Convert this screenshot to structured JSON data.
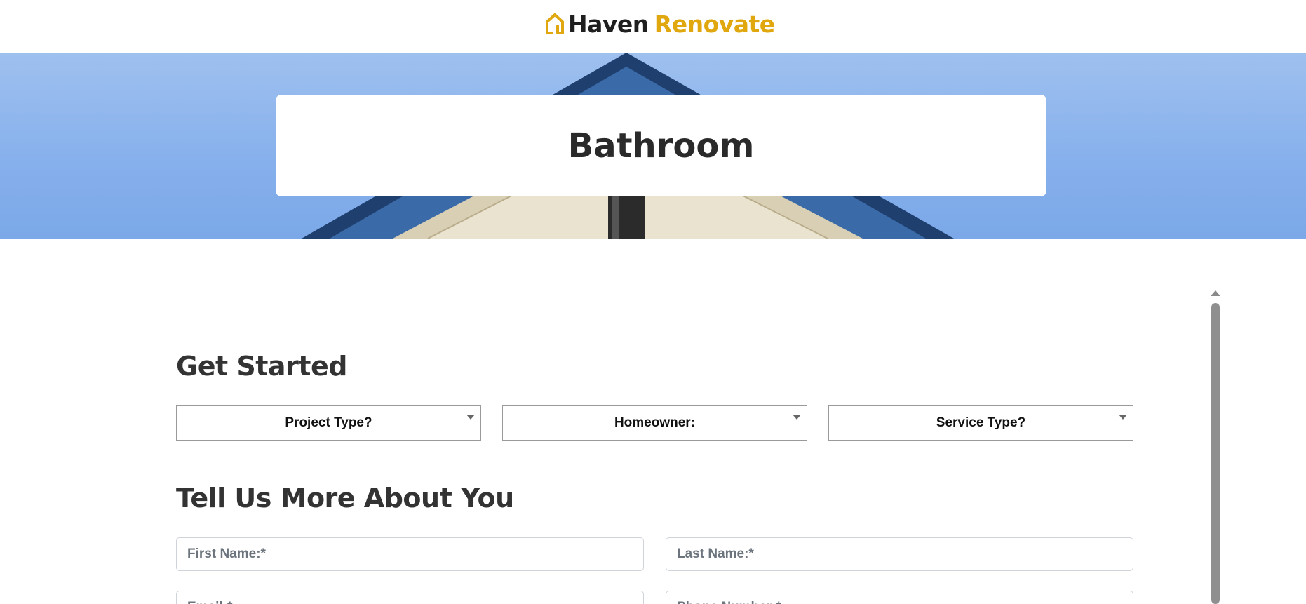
{
  "header": {
    "logo_part1": "Haven",
    "logo_part2": "Renovate",
    "logo_icon": "house-outline-icon",
    "brand_color": "#e0a80e"
  },
  "hero": {
    "title": "Bathroom"
  },
  "section_get_started": {
    "heading": "Get Started",
    "selects": [
      {
        "label": "Project Type?"
      },
      {
        "label": "Homeowner:"
      },
      {
        "label": "Service Type?"
      }
    ]
  },
  "section_about": {
    "heading": "Tell Us More About You",
    "fields": [
      {
        "placeholder": "First Name:*"
      },
      {
        "placeholder": "Last Name:*"
      },
      {
        "placeholder": "Email:*"
      },
      {
        "placeholder": "Phone Number:*"
      }
    ]
  }
}
